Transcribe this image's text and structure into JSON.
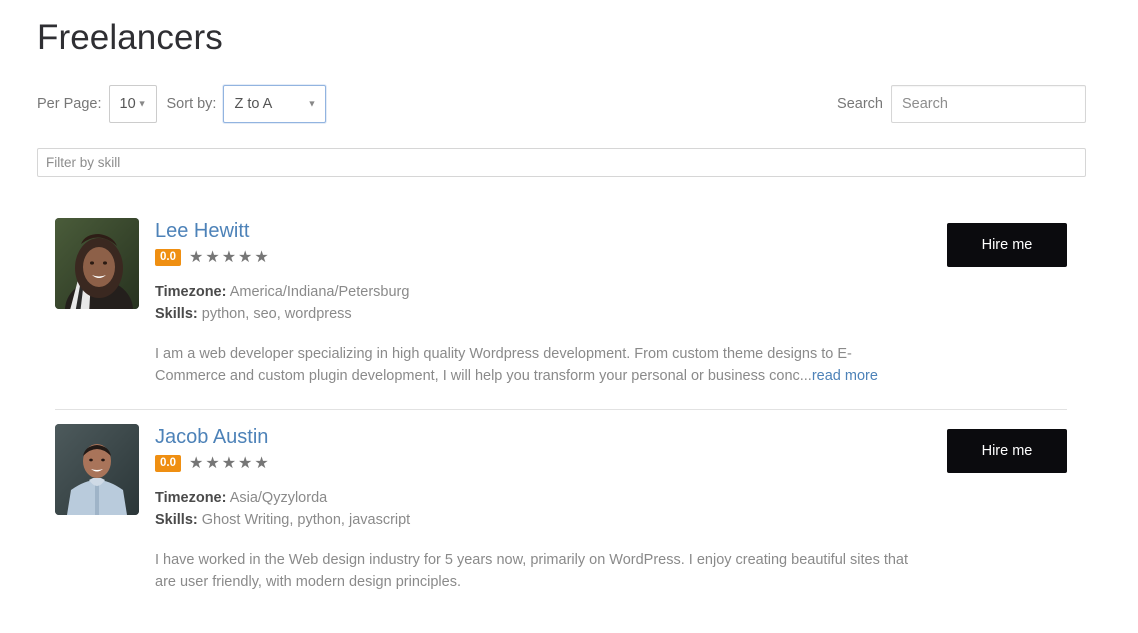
{
  "header": {
    "title": "Freelancers"
  },
  "toolbar": {
    "per_page_label": "Per Page:",
    "per_page_value": "10",
    "sort_by_label": "Sort by:",
    "sort_by_value": "Z to A",
    "search_label": "Search",
    "search_value": "",
    "search_placeholder": "Search",
    "caret": "▼"
  },
  "skill_filter": {
    "value": "",
    "placeholder": "Filter by skill"
  },
  "star_glyph": "★",
  "freelancers": [
    {
      "name": "Lee Hewitt",
      "rating": "0.0",
      "stars": 5,
      "timezone_label": "Timezone:",
      "timezone": "America/Indiana/Petersburg",
      "skills_label": "Skills:",
      "skills": "python, seo, wordpress",
      "description": "I am a web developer specializing in high quality Wordpress development. From custom theme designs to E-Commerce and custom plugin development, I will help you transform your personal or business conc...",
      "read_more": "read more",
      "hire_label": "Hire me",
      "avatar": "photo-woman-smiling"
    },
    {
      "name": "Jacob Austin",
      "rating": "0.0",
      "stars": 5,
      "timezone_label": "Timezone:",
      "timezone": "Asia/Qyzylorda",
      "skills_label": "Skills:",
      "skills": "Ghost Writing, python, javascript",
      "description": "I have worked in the Web design industry for 5 years now, primarily on WordPress. I enjoy creating beautiful sites that are user friendly, with modern design principles.",
      "read_more": "",
      "hire_label": "Hire me",
      "avatar": "photo-man-blue-shirt"
    }
  ],
  "colors": {
    "link": "#4d82b8",
    "badge": "#ef8f12",
    "button": "#0b0b0e",
    "star": "#767676",
    "text_muted": "#8a8a8a"
  }
}
